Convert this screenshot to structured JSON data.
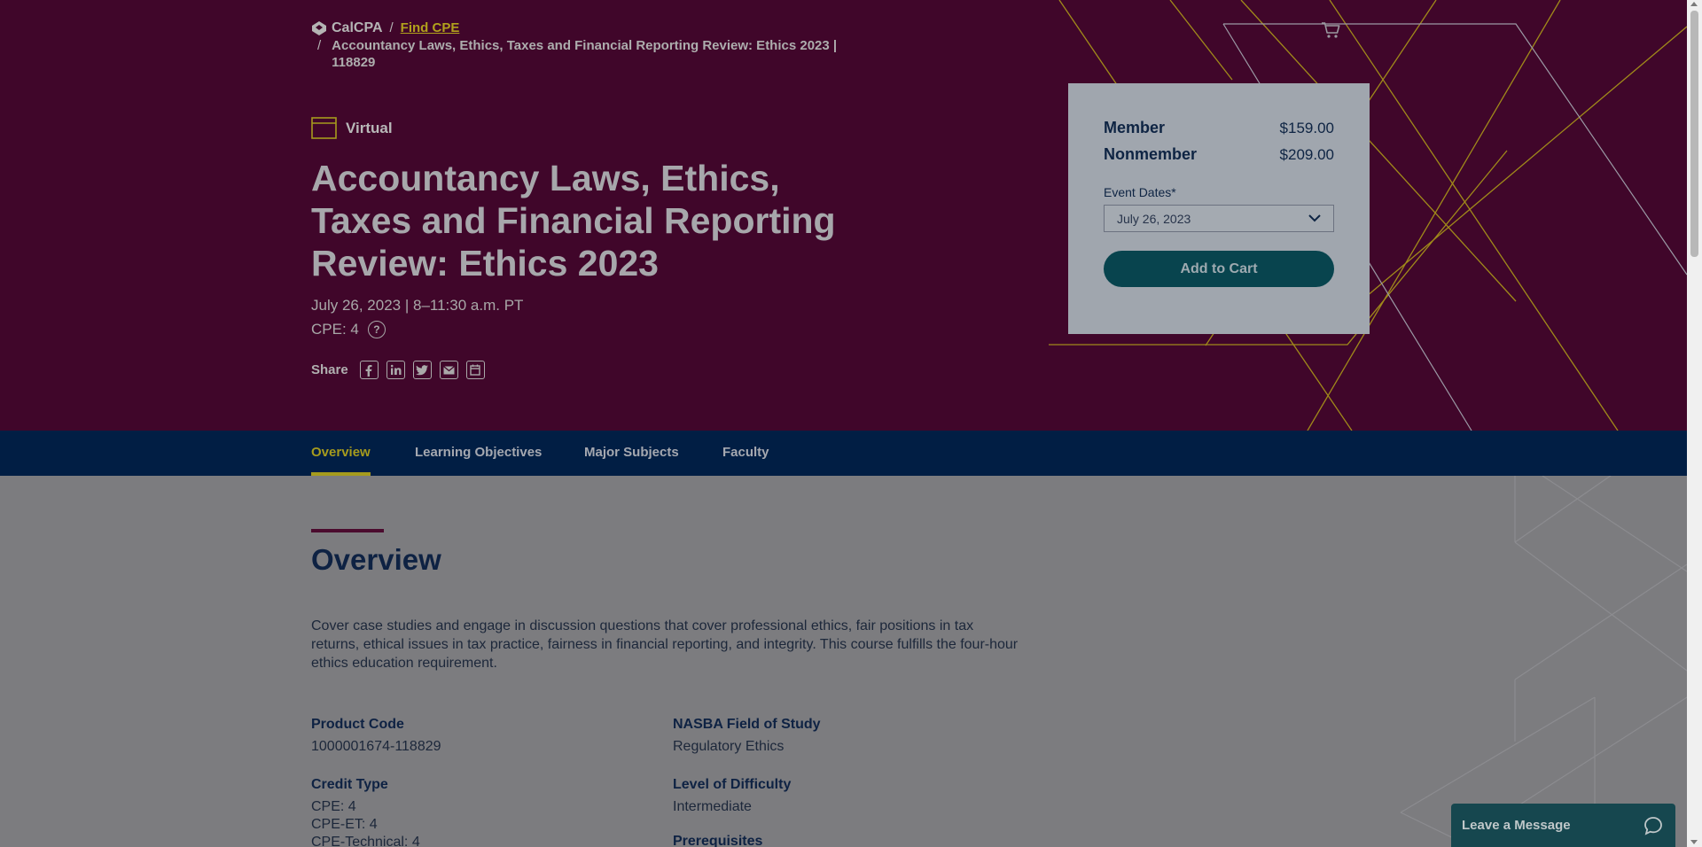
{
  "breadcrumb": {
    "logo_text": "CalCPA",
    "separator": "/",
    "find_cpe": "Find CPE",
    "current": "Accountancy Laws, Ethics, Taxes and Financial Reporting Review: Ethics 2023 | 118829"
  },
  "event": {
    "format": "Virtual",
    "title": "Accountancy Laws, Ethics, Taxes and Financial Reporting Review: Ethics 2023",
    "date_time": "July 26, 2023 | 8–11:30 a.m. PT",
    "cpe": "CPE: 4",
    "help_symbol": "?",
    "share_label": "Share",
    "share_icons": [
      "facebook-icon",
      "linkedin-icon",
      "twitter-icon",
      "email-icon",
      "calendar-icon"
    ]
  },
  "pricing": {
    "member_label": "Member",
    "member_price": "$159.00",
    "nonmember_label": "Nonmember",
    "nonmember_price": "$209.00",
    "dates_label": "Event Dates*",
    "selected_date": "July 26, 2023",
    "add_to_cart": "Add to Cart"
  },
  "tabs": [
    {
      "label": "Overview",
      "active": true
    },
    {
      "label": "Learning Objectives",
      "active": false
    },
    {
      "label": "Major Subjects",
      "active": false
    },
    {
      "label": "Faculty",
      "active": false
    }
  ],
  "overview": {
    "heading": "Overview",
    "description": "Cover case studies and engage in discussion questions that cover professional ethics, fair positions in tax returns, ethical issues in tax practice, fairness in financial reporting, and integrity. This course fulfills the four-hour ethics education requirement.",
    "product_code_label": "Product Code",
    "product_code": "1000001674-118829",
    "credit_type_label": "Credit Type",
    "credit_lines": [
      "CPE: 4",
      "CPE-ET: 4",
      "CPE-Technical: 4"
    ],
    "field_of_study_label": "NASBA Field of Study",
    "field_of_study": "Regulatory Ethics",
    "difficulty_label": "Level of Difficulty",
    "difficulty": "Intermediate",
    "prerequisites_label": "Prerequisites"
  },
  "chat": {
    "label": "Leave a Message"
  },
  "colors": {
    "hero_bg": "#40062a",
    "nav_bg": "#011e44",
    "accent_gold": "#a69b1d",
    "button_teal": "#08444e"
  }
}
